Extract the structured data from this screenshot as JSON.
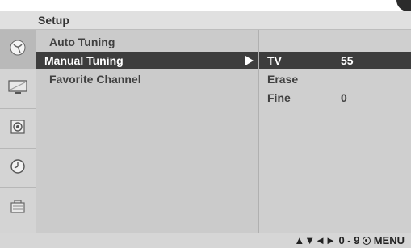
{
  "header": {
    "title": "Setup"
  },
  "sidebar": {
    "items": [
      {
        "icon": "satellite-dish-icon"
      },
      {
        "icon": "tv-screen-icon"
      },
      {
        "icon": "speaker-icon"
      },
      {
        "icon": "clock-icon"
      },
      {
        "icon": "lock-icon"
      }
    ],
    "active_index": 0
  },
  "main_menu": {
    "items": [
      {
        "label": "Auto Tuning"
      },
      {
        "label": "Manual Tuning"
      },
      {
        "label": "Favorite Channel"
      }
    ],
    "selected_index": 1
  },
  "sub_menu": {
    "items": [
      {
        "label": "TV",
        "value": "55"
      },
      {
        "label": "Erase",
        "value": ""
      },
      {
        "label": "Fine",
        "value": "0"
      }
    ],
    "selected_index": 0
  },
  "footer": {
    "nav_arrows": "▲▼◄►",
    "range": "0 - 9",
    "menu": "MENU"
  },
  "colors": {
    "highlight_bg": "#3d3d3d",
    "panel_bg": "#cbcbcb",
    "title_bg": "#e0e0e0"
  }
}
